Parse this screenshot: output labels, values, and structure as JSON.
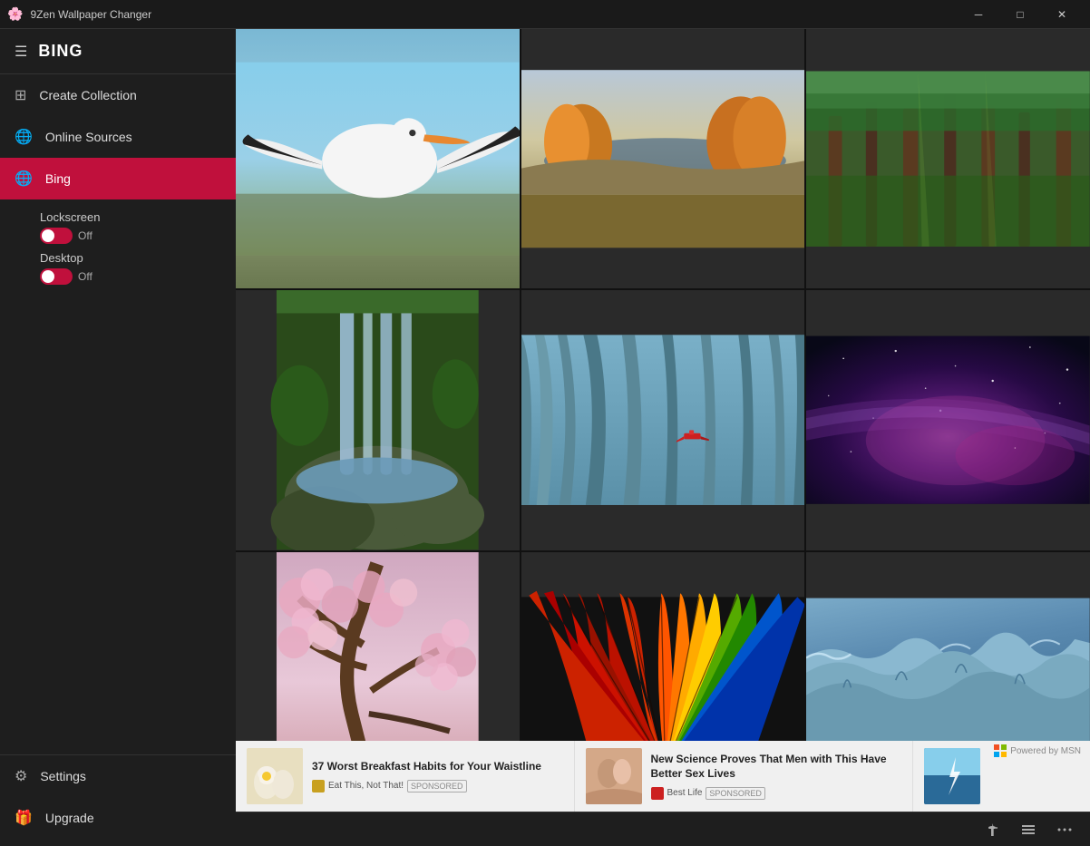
{
  "app": {
    "title": "9Zen Wallpaper Changer"
  },
  "titlebar": {
    "minimize_label": "─",
    "maximize_label": "□",
    "close_label": "✕"
  },
  "sidebar": {
    "title": "BING",
    "hamburger": "☰",
    "nav_items": [
      {
        "id": "create-collection",
        "label": "Create Collection",
        "icon": "⊞"
      },
      {
        "id": "online-sources",
        "label": "Online Sources",
        "icon": "🌐"
      }
    ],
    "active_source": {
      "label": "Bing",
      "icon": "🌐",
      "lockscreen_label": "Lockscreen",
      "lockscreen_toggle": "Off",
      "desktop_label": "Desktop",
      "desktop_toggle": "Off"
    },
    "bottom_items": [
      {
        "id": "settings",
        "label": "Settings",
        "icon": "⚙"
      },
      {
        "id": "upgrade",
        "label": "Upgrade",
        "icon": "🎁"
      }
    ]
  },
  "images": [
    {
      "id": "bird",
      "type": "bird",
      "alt": "White pelican bird"
    },
    {
      "id": "landscape",
      "type": "landscape",
      "alt": "Autumn landscape with horses"
    },
    {
      "id": "forest",
      "type": "forest",
      "alt": "Green forest"
    },
    {
      "id": "waterfall",
      "type": "waterfall",
      "alt": "Waterfall in forest"
    },
    {
      "id": "canyon",
      "type": "canyon",
      "alt": "Blue canyon with red plane"
    },
    {
      "id": "space",
      "type": "space",
      "alt": "Galaxy night sky"
    },
    {
      "id": "blossom",
      "type": "blossom",
      "alt": "Cherry blossom trees"
    },
    {
      "id": "feathers",
      "type": "feathers",
      "alt": "Colorful feathers"
    },
    {
      "id": "ice",
      "type": "ice",
      "alt": "Ice glacier"
    }
  ],
  "ads": [
    {
      "id": "ad1",
      "title": "37 Worst Breakfast Habits for Your Waistline",
      "source": "Eat This, Not That!",
      "sponsored": "SPONSORED",
      "thumb_type": "eggs"
    },
    {
      "id": "ad2",
      "title": "New Science Proves That Men with This Have Better Sex Lives",
      "source": "Best Life",
      "sponsored": "SPONSORED",
      "thumb_type": "couple"
    }
  ],
  "msn_badge": "Powered by MSN",
  "toolbar": {
    "pin_icon": "📌",
    "list_icon": "☰",
    "more_icon": "•••"
  }
}
